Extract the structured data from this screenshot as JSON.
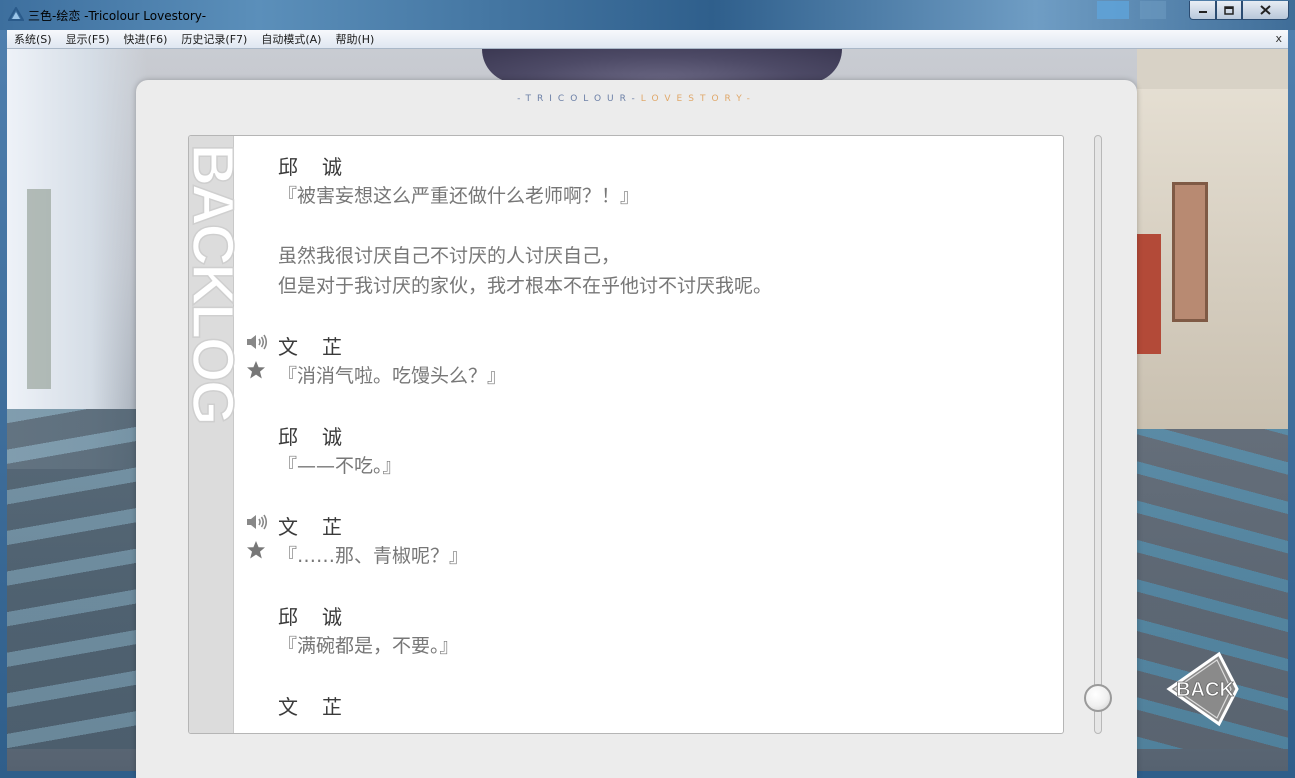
{
  "window": {
    "title": "三色-绘恋 -Tricolour Lovestory-"
  },
  "menu": {
    "items": [
      "系统(S)",
      "显示(F5)",
      "快进(F6)",
      "历史记录(F7)",
      "自动模式(A)",
      "帮助(H)"
    ],
    "close": "x"
  },
  "panel": {
    "logo_left": "-TRICOLOUR-",
    "logo_right": "LOVESTORY-",
    "vertical_label": "BACKLOG"
  },
  "entries": [
    {
      "name": "邱　诚",
      "lines": [
        "『被害妄想这么严重还做什么老师啊？！』",
        "",
        "虽然我很讨厌自己不讨厌的人讨厌自己，",
        "但是对于我讨厌的家伙，我才根本不在乎他讨不讨厌我呢。"
      ],
      "voice": false
    },
    {
      "name": "文　芷",
      "lines": [
        "『消消气啦。吃馒头么？』"
      ],
      "voice": true
    },
    {
      "name": "邱　诚",
      "lines": [
        "『——不吃。』"
      ],
      "voice": false
    },
    {
      "name": "文　芷",
      "lines": [
        "『……那、青椒呢？』"
      ],
      "voice": true
    },
    {
      "name": "邱　诚",
      "lines": [
        "『满碗都是，不要。』"
      ],
      "voice": false
    },
    {
      "name": "文　芷",
      "lines": [],
      "voice": false
    }
  ],
  "back_button": {
    "label": "BACK"
  },
  "scroll": {
    "position": 0.96
  },
  "colors": {
    "panel_bg": "#ececec",
    "name_text": "#3a3a3a",
    "line_text": "#777777",
    "logo_blue": "#6b7fa6",
    "logo_orange": "#e0a86a"
  }
}
